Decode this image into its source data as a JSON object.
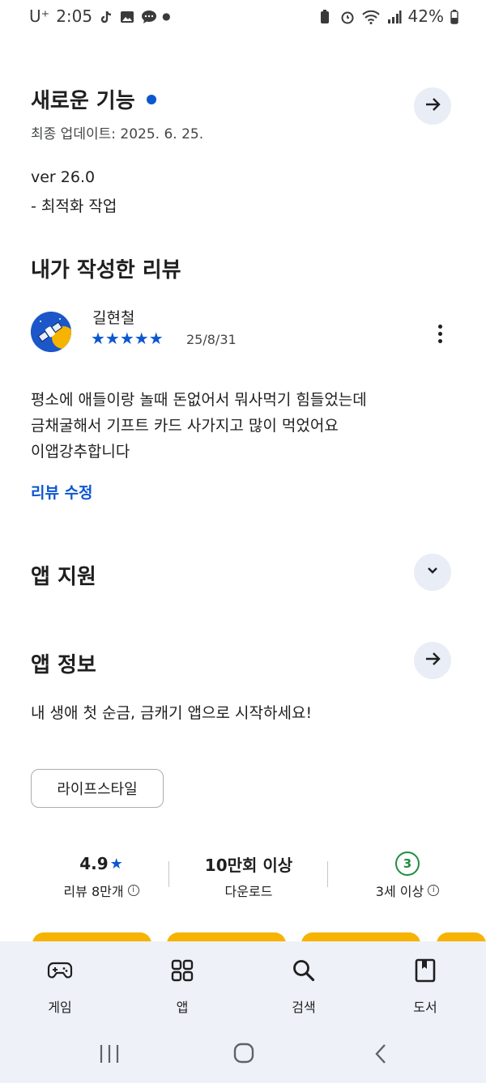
{
  "status_bar": {
    "carrier": "U⁺",
    "time": "2:05",
    "battery": "42%"
  },
  "whats_new": {
    "title": "새로운 기능",
    "updated": "최종 업데이트: 2025. 6. 25.",
    "version": "ver 26.0",
    "note": "- 최적화 작업"
  },
  "my_review": {
    "title": "내가 작성한 리뷰",
    "author": "길현철",
    "stars": "★★★★★",
    "date": "25/8/31",
    "text_line1": "평소에 애들이랑 놀때 돈없어서 뭐사먹기 힘들었는데",
    "text_line2": "금채굴해서 기프트 카드 사가지고 많이 먹었어요",
    "text_line3": "이앱강추합니다",
    "edit_label": "리뷰 수정"
  },
  "app_support": {
    "title": "앱 지원"
  },
  "app_info": {
    "title": "앱 정보",
    "description": "내 생애 첫 순금, 금캐기 앱으로 시작하세요!",
    "category": "라이프스타일"
  },
  "stats": {
    "rating": "4.9",
    "rating_star": "★",
    "reviews": "리뷰 8만개",
    "downloads": "10만회 이상",
    "downloads_label": "다운로드",
    "age_badge": "3",
    "age_label": "3세 이상"
  },
  "bottom_nav": {
    "games": "게임",
    "apps": "앱",
    "search": "검색",
    "books": "도서"
  },
  "colors": {
    "accent": "#0b57d0",
    "button_bg": "#e8edf6",
    "nav_bg": "#eef1f8",
    "age_green": "#1e8e3e",
    "promo_yellow": "#f6b300"
  }
}
